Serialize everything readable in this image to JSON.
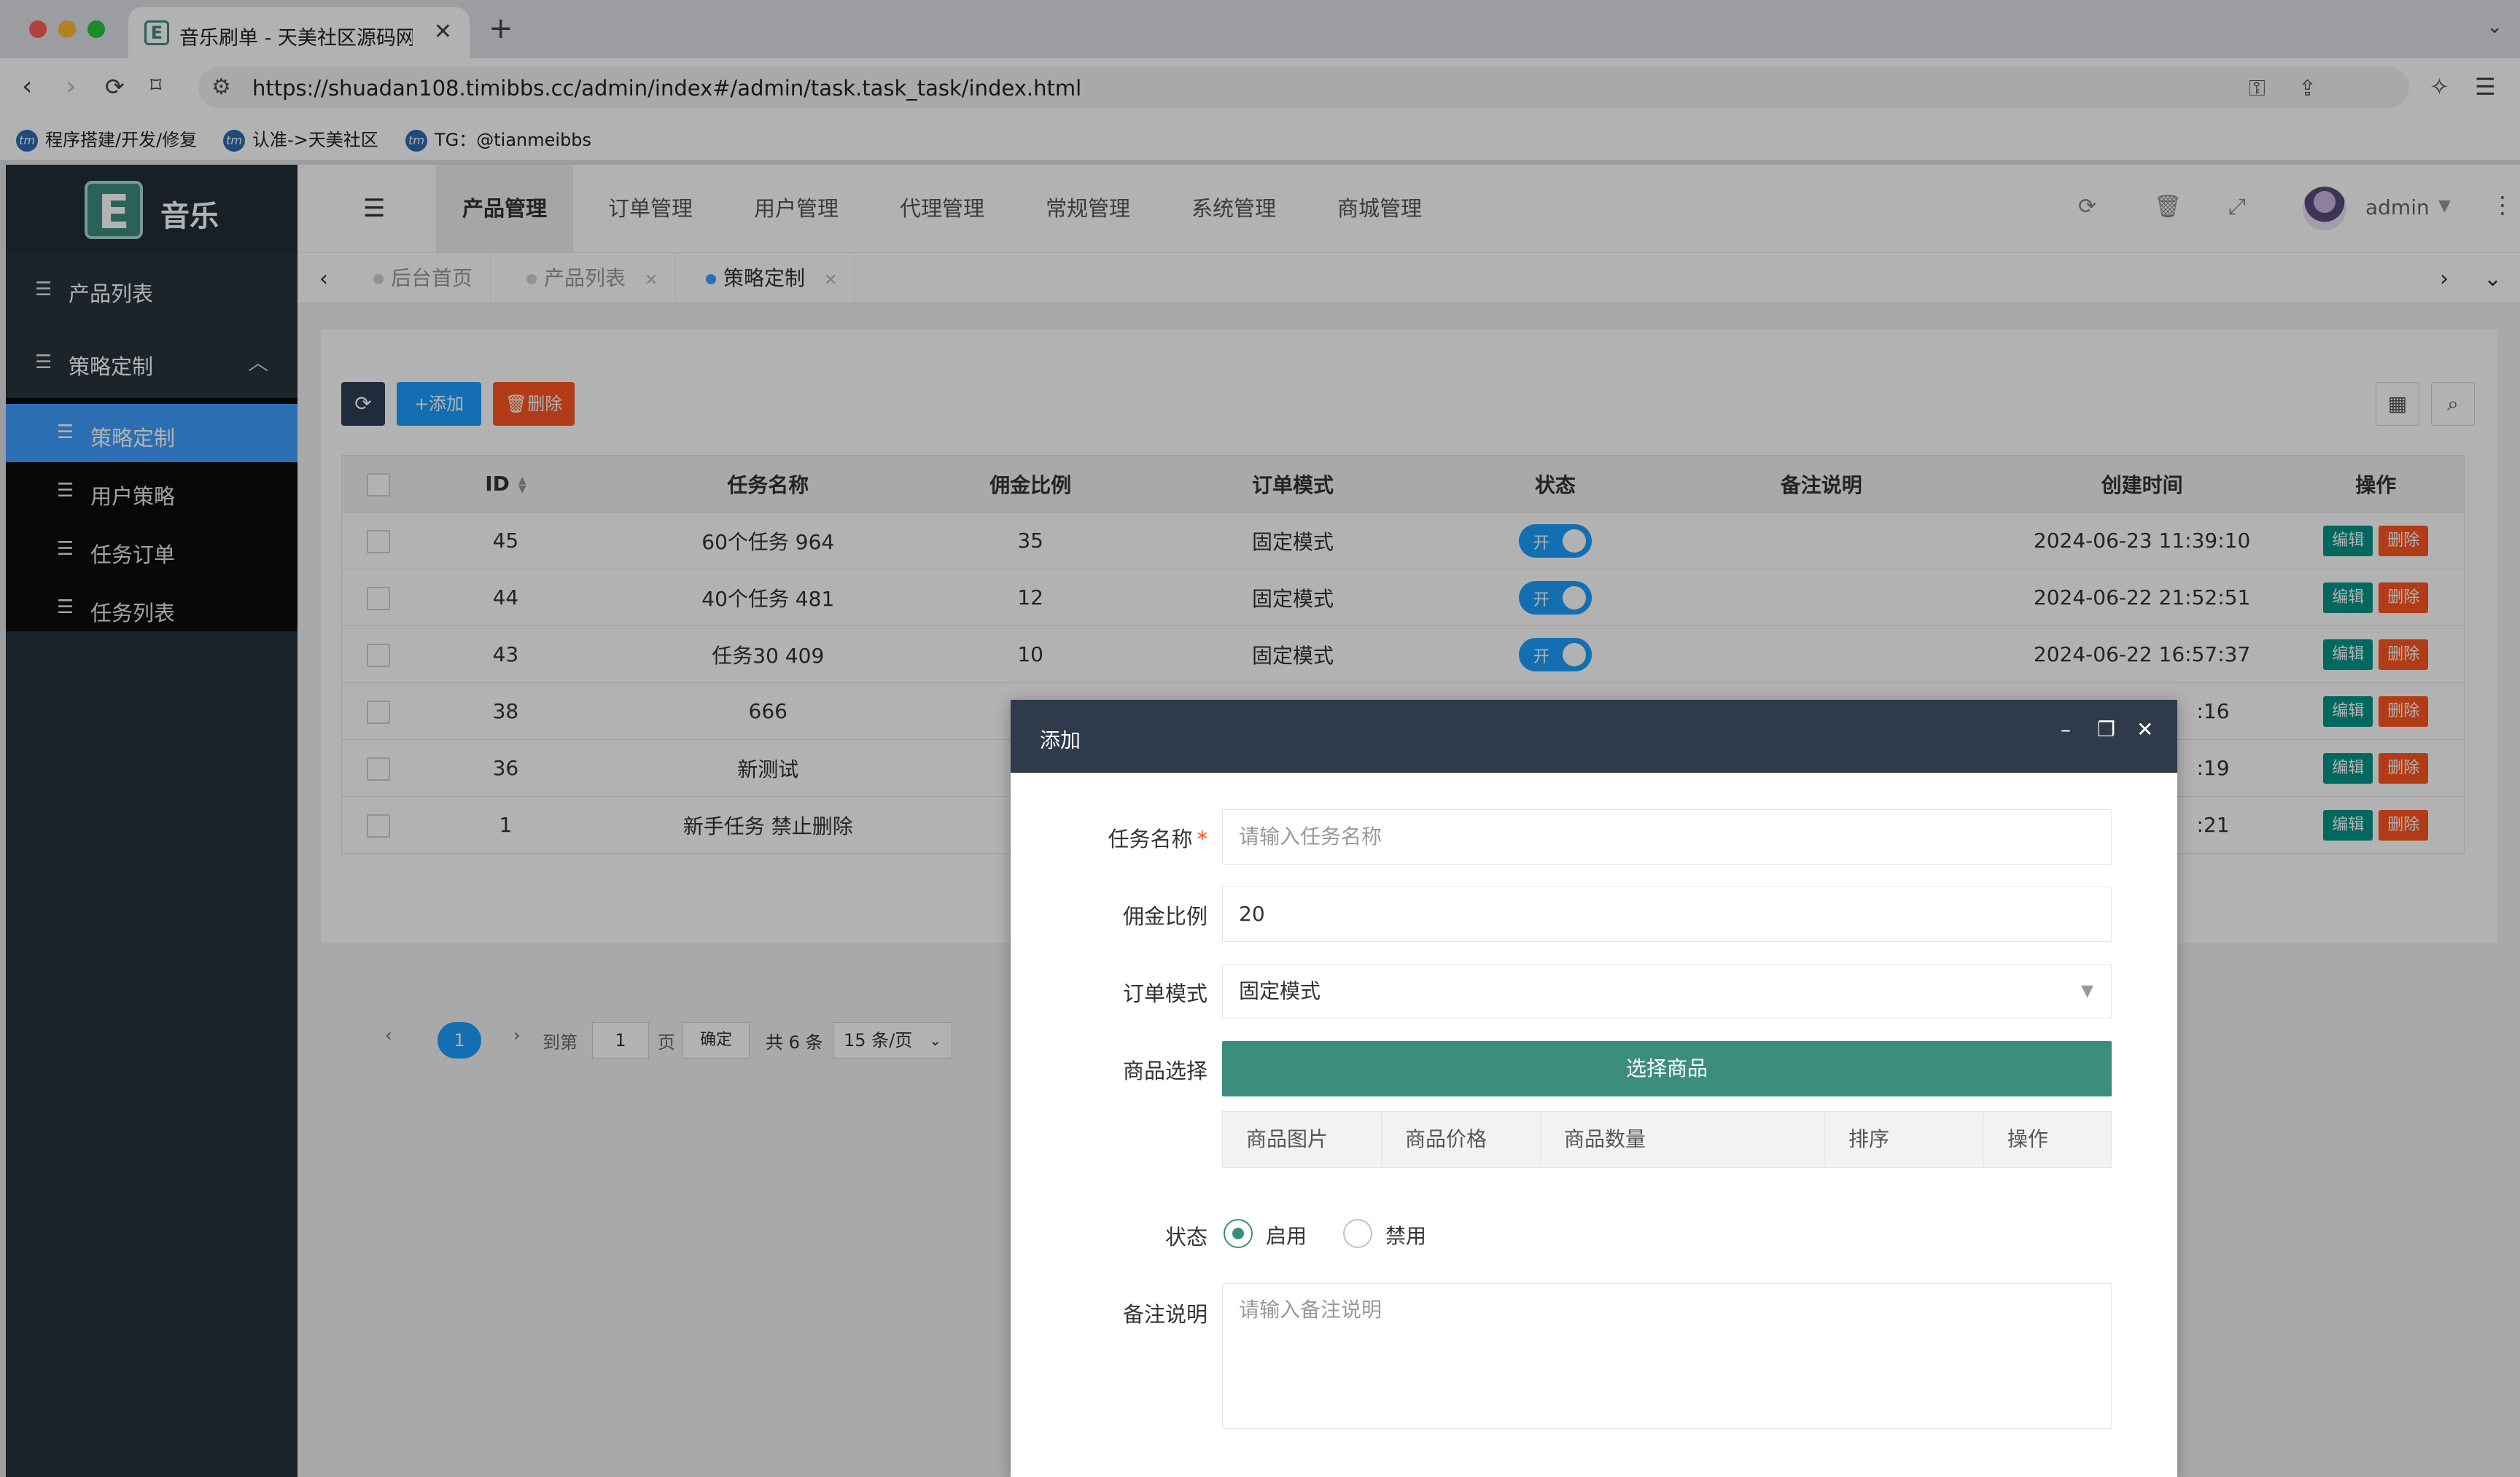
{
  "browser": {
    "tab_title": "音乐刷单 - 天美社区源码网timibbs",
    "url": "https://shuadan108.timibbs.cc/admin/index#/admin/task.task_task/index.html",
    "bookmarks": [
      "程序搭建/开发/修复",
      "认准->天美社区",
      "TG：@tianmeibbs"
    ],
    "bookmark_icon": "tm"
  },
  "app": {
    "logo_letter": "E",
    "logo_text": "音乐",
    "sidebar": {
      "items": [
        {
          "label": "产品列表",
          "icon": "list-icon"
        },
        {
          "label": "策略定制",
          "icon": "list-icon",
          "expanded": true
        }
      ],
      "subitems": [
        {
          "label": "策略定制",
          "active": true
        },
        {
          "label": "用户策略"
        },
        {
          "label": "任务订单"
        },
        {
          "label": "任务列表"
        }
      ]
    },
    "topnav": [
      "产品管理",
      "订单管理",
      "用户管理",
      "代理管理",
      "常规管理",
      "系统管理",
      "商城管理"
    ],
    "user": "admin",
    "page_tabs": [
      {
        "label": "后台首页"
      },
      {
        "label": "产品列表"
      },
      {
        "label": "策略定制",
        "active": true
      }
    ],
    "toolbar": {
      "add": "+添加",
      "delete": "删除"
    },
    "table": {
      "headers": [
        "ID",
        "任务名称",
        "佣金比例",
        "订单模式",
        "状态",
        "备注说明",
        "创建时间",
        "操作"
      ],
      "rows": [
        {
          "id": "45",
          "name": "60个任务 964",
          "ratio": "35",
          "mode": "固定模式",
          "status": "开",
          "remark": "",
          "created": "2024-06-23 11:39:10"
        },
        {
          "id": "44",
          "name": "40个任务 481",
          "ratio": "12",
          "mode": "固定模式",
          "status": "开",
          "remark": "",
          "created": "2024-06-22 21:52:51"
        },
        {
          "id": "43",
          "name": "任务30 409",
          "ratio": "10",
          "mode": "固定模式",
          "status": "开",
          "remark": "",
          "created": "2024-06-22 16:57:37"
        },
        {
          "id": "38",
          "name": "666",
          "ratio": "",
          "mode": "",
          "status": "",
          "remark": "",
          "created": ":16"
        },
        {
          "id": "36",
          "name": "新测试",
          "ratio": "",
          "mode": "",
          "status": "",
          "remark": "",
          "created": ":19"
        },
        {
          "id": "1",
          "name": "新手任务 禁止删除",
          "ratio": "",
          "mode": "",
          "status": "",
          "remark": "",
          "created": ":21"
        }
      ],
      "edit_label": "编辑",
      "delete_label": "删除"
    },
    "pager": {
      "current": "1",
      "goto_label": "到第",
      "goto_value": "1",
      "page_unit": "页",
      "ok": "确定",
      "total": "共 6 条",
      "per_page": "15 条/页"
    }
  },
  "modal": {
    "title": "添加",
    "task_name_label": "任务名称",
    "task_name_placeholder": "请输入任务名称",
    "ratio_label": "佣金比例",
    "ratio_value": "20",
    "mode_label": "订单模式",
    "mode_value": "固定模式",
    "goods_label": "商品选择",
    "goods_button": "选择商品",
    "goods_headers": [
      "商品图片",
      "商品价格",
      "商品数量",
      "排序",
      "操作"
    ],
    "status_label": "状态",
    "status_on": "启用",
    "status_off": "禁用",
    "remark_label": "备注说明",
    "remark_placeholder": "请输入备注说明"
  }
}
